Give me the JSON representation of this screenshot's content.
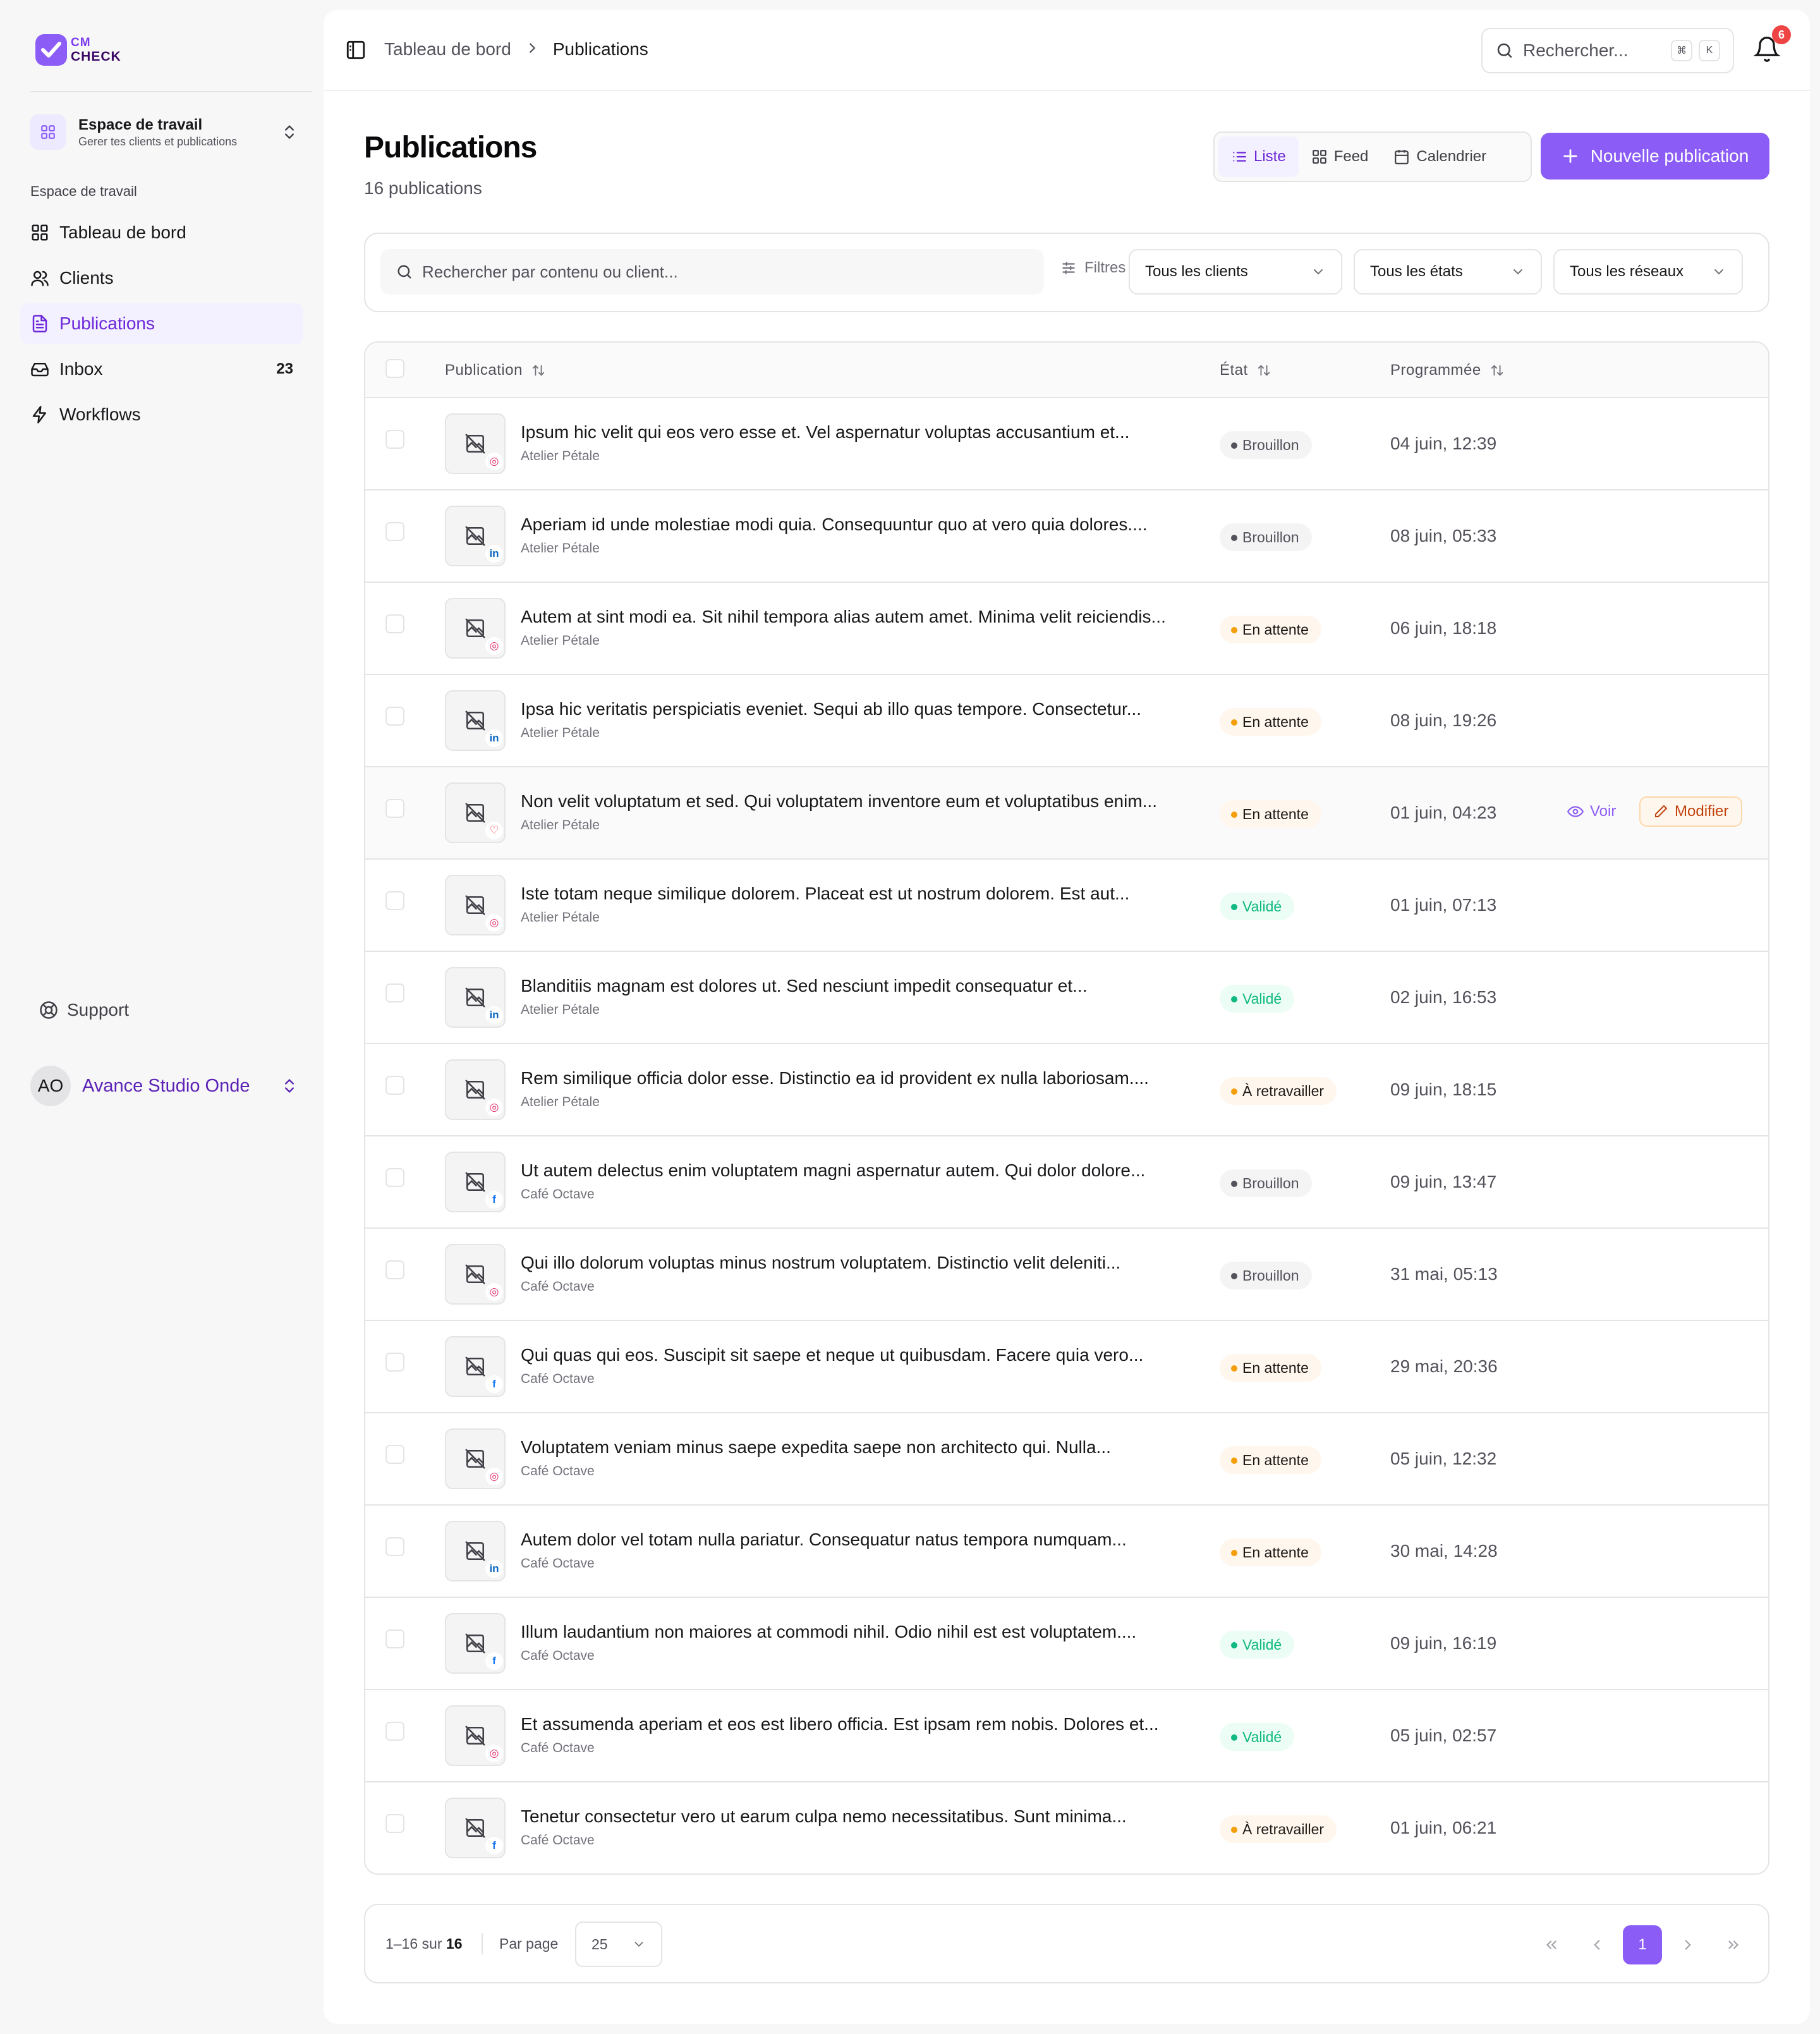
{
  "brand": {
    "line1": "CM",
    "line2": "CHECK",
    "accent": "#8b5cf6"
  },
  "workspace": {
    "title": "Espace de travail",
    "subtitle": "Gerer tes clients et publications"
  },
  "nav": {
    "section_label": "Espace de travail",
    "items": [
      {
        "label": "Tableau de bord",
        "icon": "grid-icon"
      },
      {
        "label": "Clients",
        "icon": "users-icon"
      },
      {
        "label": "Publications",
        "icon": "document-icon"
      },
      {
        "label": "Inbox",
        "icon": "inbox-icon",
        "count": "23"
      },
      {
        "label": "Workflows",
        "icon": "bolt-icon"
      }
    ]
  },
  "support": {
    "label": "Support"
  },
  "user": {
    "initials": "AO",
    "name": "Avance Studio Onde"
  },
  "header": {
    "breadcrumb": [
      "Tableau de bord",
      "Publications"
    ],
    "search_placeholder": "Rechercher...",
    "kbd": [
      "⌘",
      "K"
    ],
    "notifications": "6"
  },
  "page": {
    "title": "Publications",
    "count": "16 publications"
  },
  "views": {
    "items": [
      "Liste",
      "Feed",
      "Calendrier"
    ],
    "active": "Liste"
  },
  "new_button": "Nouvelle publication",
  "filters": {
    "search_placeholder": "Rechercher par contenu ou client...",
    "label": "Filtres",
    "clients": "Tous les clients",
    "states": "Tous les états",
    "networks": "Tous les réseaux"
  },
  "table": {
    "columns": [
      "Publication",
      "État",
      "Programmée"
    ],
    "rows": [
      {
        "title": "Ipsum hic velit qui eos vero esse et. Vel aspernatur voluptas accusantium et...",
        "client": "Atelier Pétale",
        "network": "instagram",
        "state": "Brouillon",
        "date": "04 juin, 12:39"
      },
      {
        "title": "Aperiam id unde molestiae modi quia. Consequuntur quo at vero quia dolores....",
        "client": "Atelier Pétale",
        "network": "linkedin",
        "state": "Brouillon",
        "date": "08 juin, 05:33"
      },
      {
        "title": "Autem at sint modi ea. Sit nihil tempora alias autem amet. Minima velit reiciendis...",
        "client": "Atelier Pétale",
        "network": "instagram",
        "state": "En attente",
        "date": "06 juin, 18:18"
      },
      {
        "title": "Ipsa hic veritatis perspiciatis eveniet. Sequi ab illo quas tempore. Consectetur...",
        "client": "Atelier Pétale",
        "network": "linkedin",
        "state": "En attente",
        "date": "08 juin, 19:26"
      },
      {
        "title": "Non velit voluptatum et sed. Qui voluptatem inventore eum et voluptatibus enim...",
        "client": "Atelier Pétale",
        "network": "heart",
        "state": "En attente",
        "date": "01 juin, 04:23",
        "hover": true
      },
      {
        "title": "Iste totam neque similique dolorem. Placeat est ut nostrum dolorem. Est aut...",
        "client": "Atelier Pétale",
        "network": "instagram",
        "state": "Validé",
        "date": "01 juin, 07:13"
      },
      {
        "title": "Blanditiis magnam est dolores ut. Sed nesciunt impedit consequatur et...",
        "client": "Atelier Pétale",
        "network": "linkedin",
        "state": "Validé",
        "date": "02 juin, 16:53"
      },
      {
        "title": "Rem similique officia dolor esse. Distinctio ea id provident ex nulla laboriosam....",
        "client": "Atelier Pétale",
        "network": "instagram",
        "state": "À retravailler",
        "date": "09 juin, 18:15"
      },
      {
        "title": "Ut autem delectus enim voluptatem magni aspernatur autem. Qui dolor dolore...",
        "client": "Café Octave",
        "network": "facebook",
        "state": "Brouillon",
        "date": "09 juin, 13:47"
      },
      {
        "title": "Qui illo dolorum voluptas minus nostrum voluptatem. Distinctio velit deleniti...",
        "client": "Café Octave",
        "network": "instagram",
        "state": "Brouillon",
        "date": "31 mai, 05:13"
      },
      {
        "title": "Qui quas qui eos. Suscipit sit saepe et neque ut quibusdam. Facere quia vero...",
        "client": "Café Octave",
        "network": "facebook",
        "state": "En attente",
        "date": "29 mai, 20:36"
      },
      {
        "title": "Voluptatem veniam minus saepe expedita saepe non architecto qui. Nulla...",
        "client": "Café Octave",
        "network": "instagram",
        "state": "En attente",
        "date": "05 juin, 12:32"
      },
      {
        "title": "Autem dolor vel totam nulla pariatur. Consequatur natus tempora numquam...",
        "client": "Café Octave",
        "network": "linkedin",
        "state": "En attente",
        "date": "30 mai, 14:28"
      },
      {
        "title": "Illum laudantium non maiores at commodi nihil. Odio nihil est est voluptatem....",
        "client": "Café Octave",
        "network": "facebook",
        "state": "Validé",
        "date": "09 juin, 16:19"
      },
      {
        "title": "Et assumenda aperiam et eos est libero officia. Est ipsam rem nobis. Dolores et...",
        "client": "Café Octave",
        "network": "instagram",
        "state": "Validé",
        "date": "05 juin, 02:57"
      },
      {
        "title": "Tenetur consectetur vero ut earum culpa nemo necessitatibus. Sunt minima...",
        "client": "Café Octave",
        "network": "facebook",
        "state": "À retravailler",
        "date": "01 juin, 06:21"
      }
    ],
    "row_actions": {
      "view": "Voir",
      "edit": "Modifier"
    }
  },
  "pagination": {
    "range": "1–16 sur",
    "total": "16",
    "per_page_label": "Par page",
    "per_page": "25",
    "current": "1"
  },
  "colors": {
    "instagram": "#e1306c",
    "linkedin": "#0a66c2",
    "facebook": "#1877f2",
    "heart": "#ef4444"
  }
}
